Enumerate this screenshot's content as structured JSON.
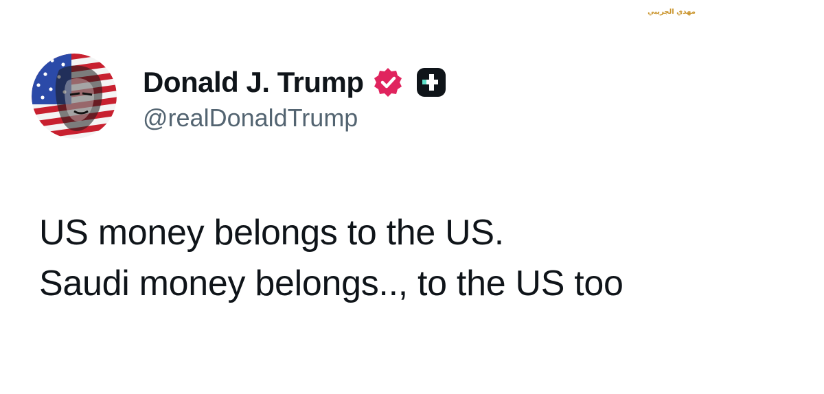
{
  "watermark": {
    "text": "مهدي الجريبي"
  },
  "post": {
    "author": {
      "display_name": "Donald J. Trump",
      "handle": "@realDonaldTrump",
      "avatar_icon": "flag-portrait-avatar",
      "verified_icon": "verified-badge-icon",
      "verified_color": "#e0245e",
      "affiliation_icon": "truth-social-logo-icon",
      "affiliation_color": "#0f1419",
      "affiliation_accent": "#5ee0c9"
    },
    "text_lines": [
      "US money belongs to the US.",
      "Saudi money belongs.., to the US too"
    ]
  },
  "colors": {
    "background": "#ffffff",
    "text": "#0f1419",
    "handle": "#536471"
  }
}
